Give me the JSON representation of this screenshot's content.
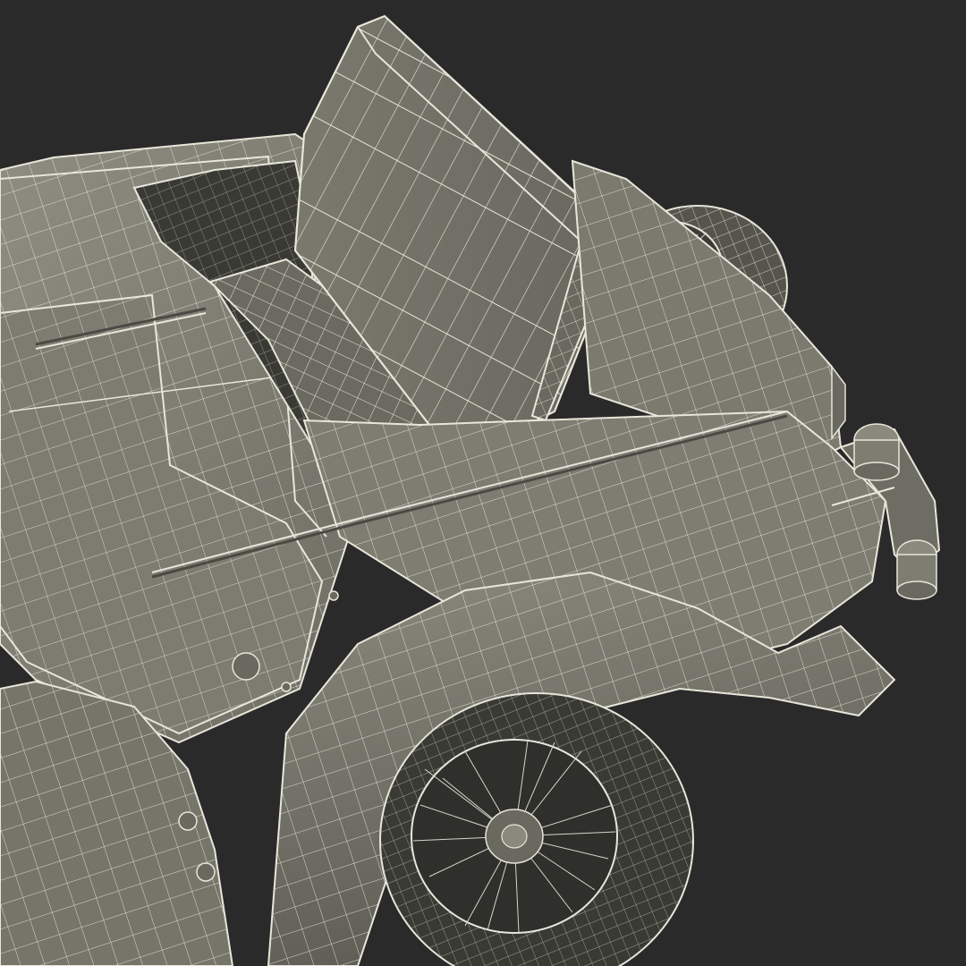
{
  "scene": {
    "subject": "wireframe-render-vintage-roadster",
    "colors": {
      "background": "#2a2a2a",
      "surface_light": "#8d8c80",
      "surface_mid": "#77766b",
      "surface_dark": "#5c5c53",
      "surface_shadow": "#3f3f3a",
      "wire": "#e8e6da",
      "spoke": "#d8d6ca"
    }
  }
}
